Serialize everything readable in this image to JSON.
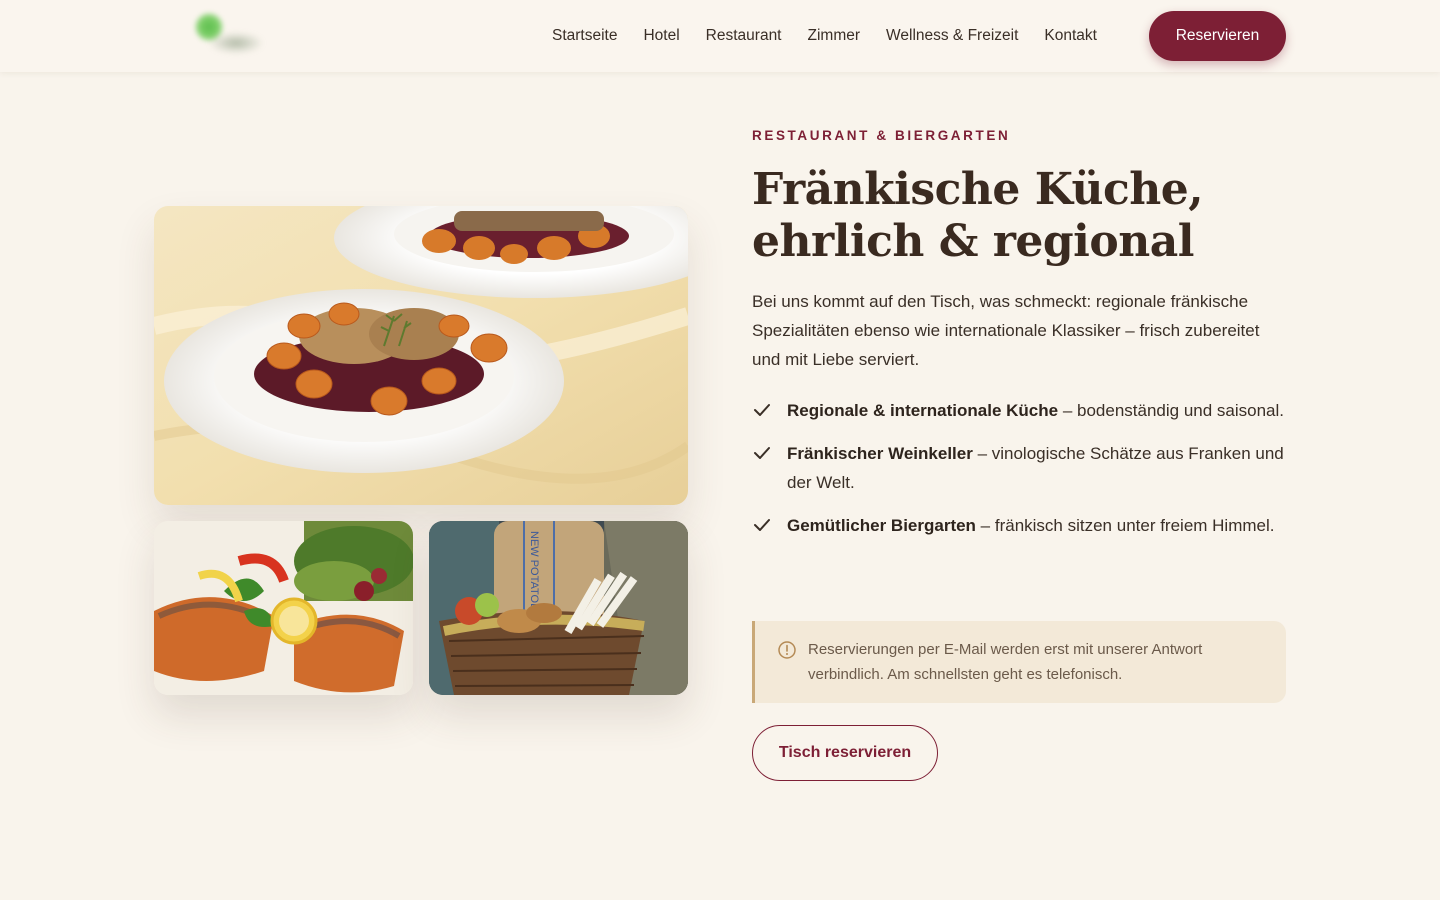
{
  "header": {
    "logo": "brand-logo",
    "nav": [
      "Startseite",
      "Hotel",
      "Restaurant",
      "Zimmer",
      "Wellness & Freizeit",
      "Kontakt"
    ],
    "cta_label": "Reservieren",
    "accent": "#7d1f35"
  },
  "section": {
    "eyebrow": "RESTAURANT & BIERGARTEN",
    "title_line1": "Fränkische Küche,",
    "title_line2": "ehrlich & regional",
    "intro": "Bei uns kommt auf den Tisch, was schmeckt: regionale fränkische Spezialitäten ebenso wie internationale Klassiker – frisch zubereitet und mit Liebe serviert.",
    "features": [
      {
        "icon": "check-icon",
        "bold": "Regionale & internationale Küche",
        "text": " – bodenständig und saisonal."
      },
      {
        "icon": "check-icon",
        "bold": "Fränkischer Weinkeller",
        "text": " – vinologische Schätze aus Franken und der Welt."
      },
      {
        "icon": "check-icon",
        "bold": "Gemütlicher Biergarten",
        "text": " – fränkisch sitzen unter freiem Himmel."
      }
    ],
    "notice": {
      "icon": "info-icon",
      "text": "Reservierungen per E-Mail werden erst mit unserer Antwort verbindlich. Am schnellsten geht es telefonisch."
    },
    "cta_label": "Tisch reservieren"
  },
  "images": {
    "main": "dish-photo",
    "small1": "fish-photo",
    "small2": "basket-photo",
    "basket_sack_text": "NEW POTATOES"
  }
}
